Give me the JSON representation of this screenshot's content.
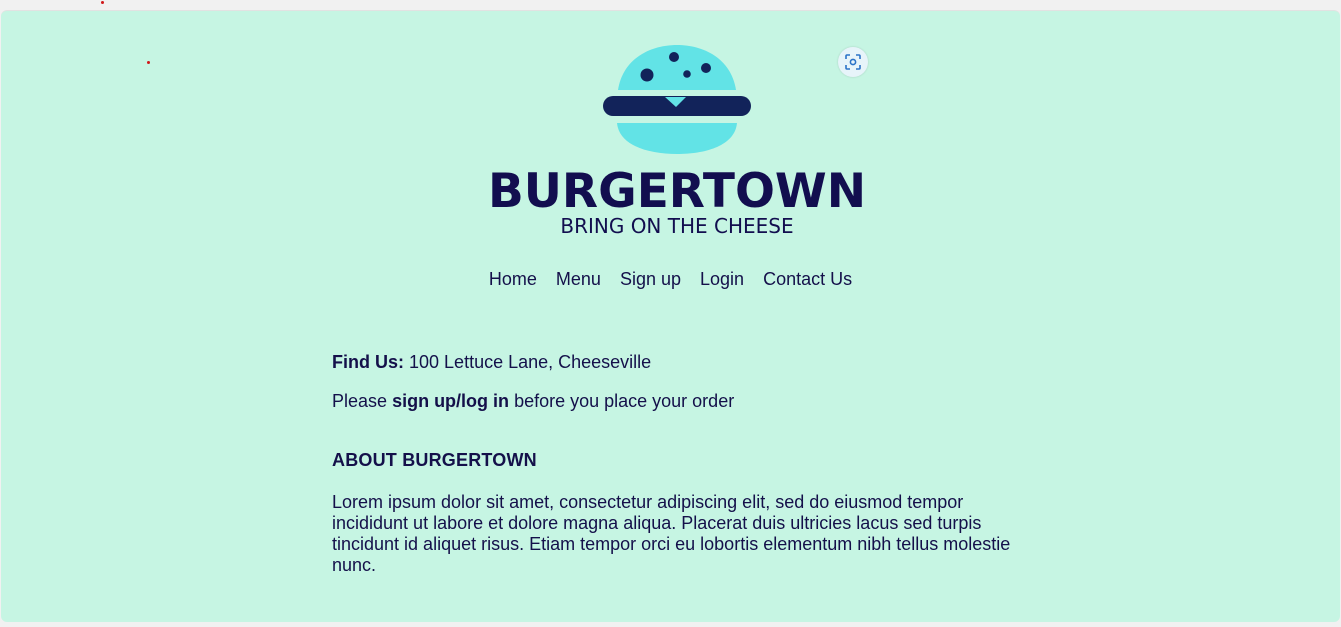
{
  "brand": {
    "name": "BURGERTOWN",
    "tagline": "BRING ON THE CHEESE",
    "colors": {
      "background": "#c6f5e3",
      "bun": "#62e3e6",
      "patty": "#12235a",
      "text": "#14104a"
    }
  },
  "nav": {
    "items": [
      "Home",
      "Menu",
      "Sign up",
      "Login",
      "Contact Us"
    ]
  },
  "find_us": {
    "label": "Find Us:",
    "address": "100 Lettuce Lane, Cheeseville"
  },
  "order_notice": {
    "prefix": "Please",
    "link": "sign up/log in",
    "suffix": "before you place your order"
  },
  "about": {
    "heading": "ABOUT BURGERTOWN",
    "body": "Lorem ipsum dolor sit amet, consectetur adipiscing elit, sed do eiusmod tempor incididunt ut labore et dolore magna aliqua. Placerat duis ultricies lacus sed turpis tincidunt id aliquet risus. Etiam tempor orci eu lobortis elementum nibh tellus molestie nunc."
  },
  "icons": {
    "scan": "screenshot-scan-icon"
  }
}
